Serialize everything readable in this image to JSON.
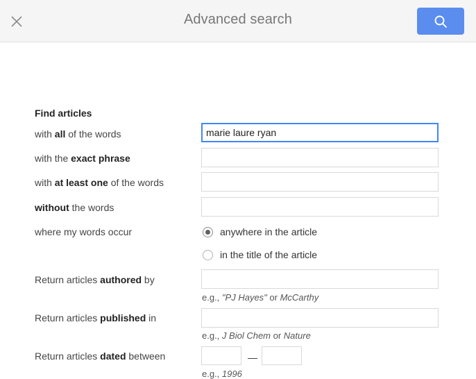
{
  "header": {
    "title": "Advanced search",
    "close_icon": "close-icon",
    "search_icon": "search-icon",
    "search_button_color": "#5b8def"
  },
  "form": {
    "section_title": "Find articles",
    "rows": [
      {
        "label_pre": "with ",
        "label_bold": "all",
        "label_post": " of the words",
        "value": "marie laure ryan",
        "placeholder": "",
        "focused": true
      },
      {
        "label_pre": "with the ",
        "label_bold": "exact phrase",
        "label_post": "",
        "value": "",
        "placeholder": "",
        "focused": false
      },
      {
        "label_pre": "with ",
        "label_bold": "at least one",
        "label_post": " of the words",
        "value": "",
        "placeholder": "",
        "focused": false
      },
      {
        "label_pre": "",
        "label_bold": "without",
        "label_post": " the words",
        "value": "",
        "placeholder": "",
        "focused": false
      }
    ],
    "occurrence": {
      "label": "where my words occur",
      "options": [
        {
          "label": "anywhere in the article",
          "selected": true
        },
        {
          "label": "in the title of the article",
          "selected": false
        }
      ]
    },
    "authored": {
      "label_pre": "Return articles ",
      "label_bold": "authored",
      "label_post": " by",
      "value": "",
      "placeholder": "",
      "hint_pre": "e.g., ",
      "hint_italic1": "\"PJ Hayes\"",
      "hint_mid": " or ",
      "hint_italic2": "McCarthy"
    },
    "published": {
      "label_pre": "Return articles ",
      "label_bold": "published",
      "label_post": " in",
      "value": "",
      "placeholder": "",
      "hint_pre": "e.g., ",
      "hint_italic1": "J Biol Chem",
      "hint_mid": " or ",
      "hint_italic2": "Nature"
    },
    "dated": {
      "label_pre": "Return articles ",
      "label_bold": "dated",
      "label_post": " between",
      "from_value": "",
      "to_value": "",
      "separator": "—",
      "hint_pre": "e.g., ",
      "hint_italic1": "1996"
    }
  }
}
